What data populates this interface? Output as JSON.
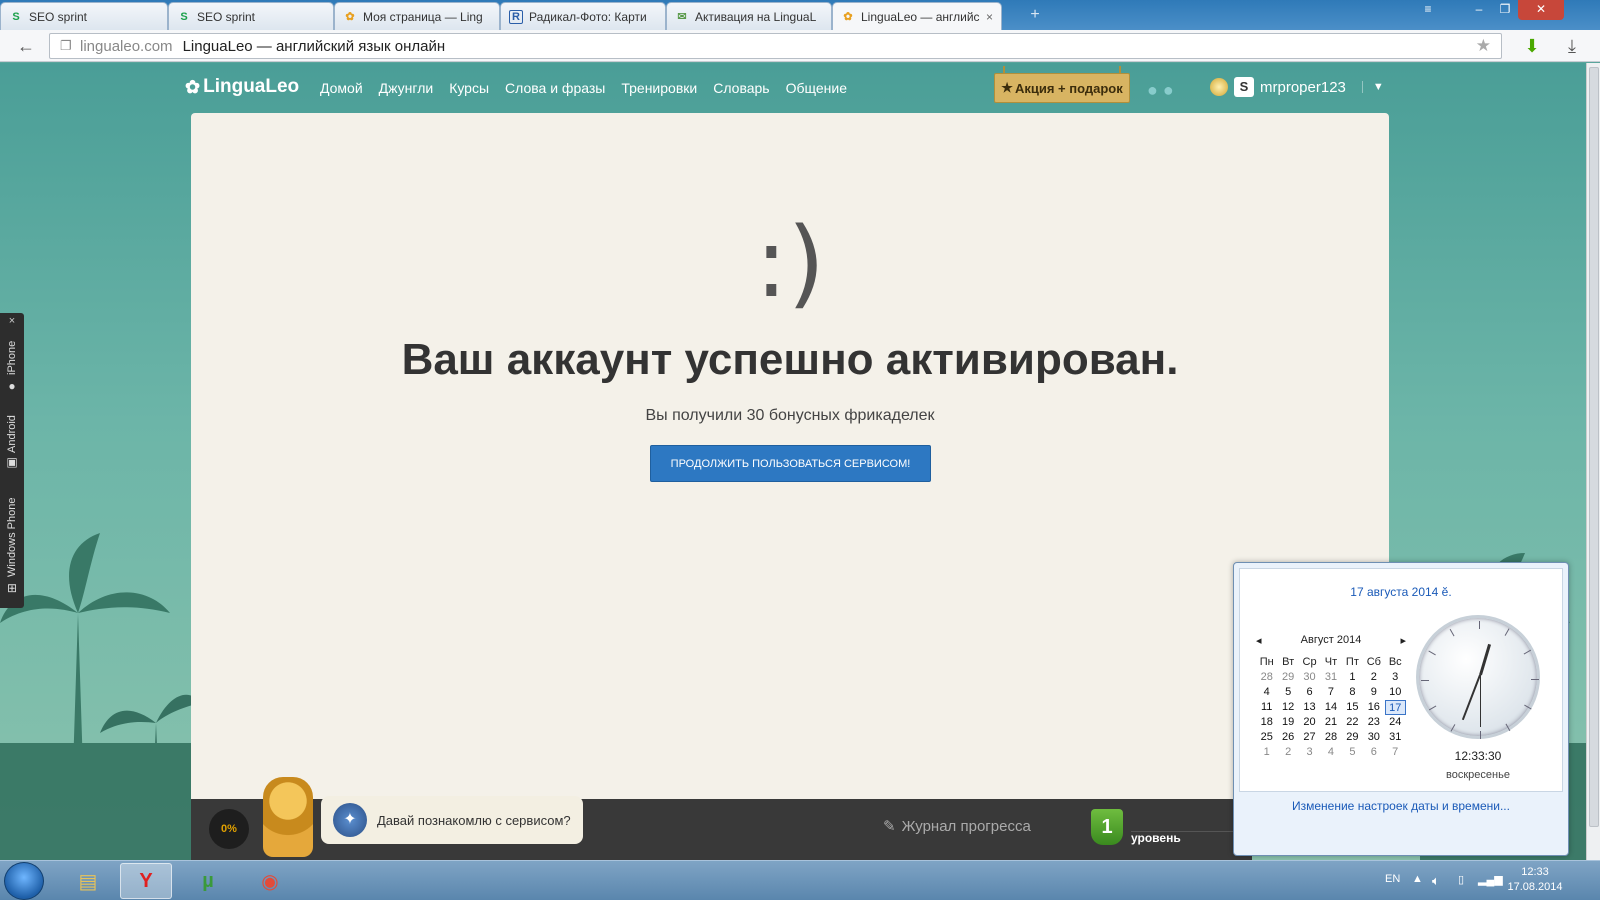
{
  "browser": {
    "tabs": [
      {
        "label": "SEO sprint",
        "icon": "seosprint-icon"
      },
      {
        "label": "SEO sprint",
        "icon": "seosprint-icon"
      },
      {
        "label": "Моя страница — Ling",
        "icon": "lingualeo-icon"
      },
      {
        "label": "Радикал-Фото: Карти",
        "icon": "radikal-icon"
      },
      {
        "label": "Активация на LinguaL",
        "icon": "mail-icon"
      },
      {
        "label": "LinguaLeo — английс",
        "icon": "lingualeo-icon"
      }
    ],
    "new_tab_glyph": "+",
    "address_domain": "lingualeo.com",
    "address_title": "LinguaLeo — английский язык онлайн"
  },
  "site": {
    "logo": "LinguaLeo",
    "nav": [
      "Домой",
      "Джунгли",
      "Курсы",
      "Слова и фразы",
      "Тренировки",
      "Словарь",
      "Общение"
    ],
    "promo": "Акция + подарок",
    "username": "mrproper123",
    "balance_badge": "S"
  },
  "main": {
    "smile": ":)",
    "headline": "Ваш аккаунт успешно активирован.",
    "subtext": "Вы получили 30 бонусных фрикаделек",
    "cta": "ПРОДОЛЖИТЬ ПОЛЬЗОВАТЬСЯ СЕРВИСОМ!"
  },
  "bottom": {
    "progress_percent": "0%",
    "bubble": "Давай познакомлю с сервисом?",
    "journal": "Журнал прогресса",
    "level_number": "1",
    "level_label": "уровень"
  },
  "social": {
    "close": "×",
    "platforms": [
      "iPhone",
      "Android",
      "Windows Phone"
    ]
  },
  "calendar": {
    "date_header": "17 августа 2014 ӗ.",
    "month": "Август 2014",
    "weekdays": [
      "Пн",
      "Вт",
      "Ср",
      "Чт",
      "Пт",
      "Сб",
      "Вс"
    ],
    "rows": [
      [
        "28",
        "29",
        "30",
        "31",
        "1",
        "2",
        "3"
      ],
      [
        "4",
        "5",
        "6",
        "7",
        "8",
        "9",
        "10"
      ],
      [
        "11",
        "12",
        "13",
        "14",
        "15",
        "16",
        "17"
      ],
      [
        "18",
        "19",
        "20",
        "21",
        "22",
        "23",
        "24"
      ],
      [
        "25",
        "26",
        "27",
        "28",
        "29",
        "30",
        "31"
      ],
      [
        "1",
        "2",
        "3",
        "4",
        "5",
        "6",
        "7"
      ]
    ],
    "today": "17",
    "clock_time": "12:33:30",
    "weekday_name": "воскресенье",
    "settings_link": "Изменение настроек даты и времени..."
  },
  "taskbar": {
    "lang": "EN",
    "time": "12:33",
    "date": "17.08.2014"
  }
}
